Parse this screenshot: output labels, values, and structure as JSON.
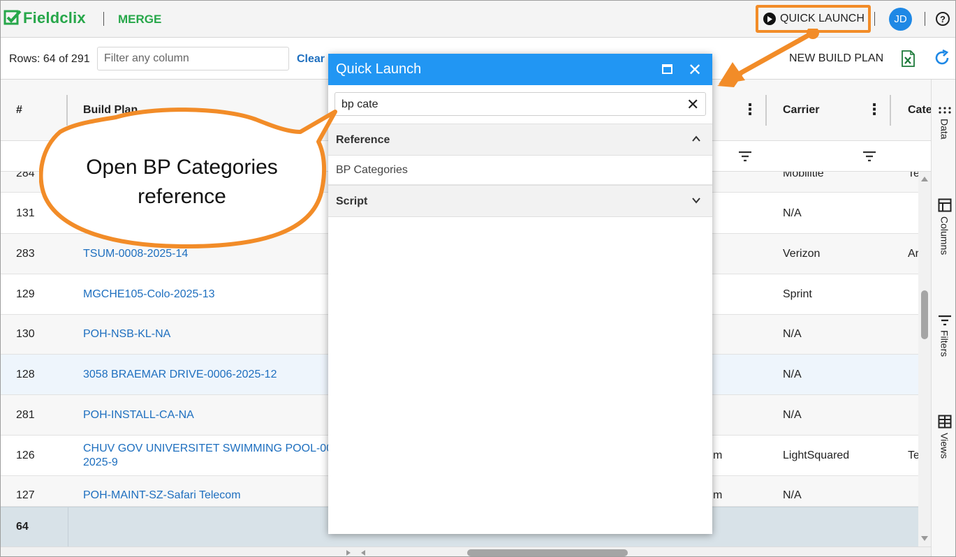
{
  "app": {
    "name": "Fieldclix",
    "module": "MERGE"
  },
  "header": {
    "quick_launch_label": "QUICK LAUNCH",
    "avatar_initials": "JD",
    "help_glyph": "?"
  },
  "toolbar": {
    "rows_label": "Rows: 64 of 291",
    "filter_placeholder": "Filter any column",
    "clear_label": "Clear",
    "new_build_plan_label": "NEW BUILD PLAN"
  },
  "grid": {
    "columns": [
      "#",
      "Build Plan",
      "Carrier",
      "Cate"
    ],
    "rows": [
      {
        "num": "284",
        "build_plan": "",
        "mid": "",
        "carrier": "Mobilitie",
        "category": "Te"
      },
      {
        "num": "131",
        "build_plan": "",
        "mid": "",
        "carrier": "N/A",
        "category": ""
      },
      {
        "num": "283",
        "build_plan": "TSUM-0008-2025-14",
        "mid": "",
        "carrier": "Verizon",
        "category": "Ar"
      },
      {
        "num": "129",
        "build_plan": "MGCHE105-Colo-2025-13",
        "mid": "",
        "carrier": "Sprint",
        "category": ""
      },
      {
        "num": "130",
        "build_plan": "POH-NSB-KL-NA",
        "mid": "",
        "carrier": "N/A",
        "category": ""
      },
      {
        "num": "128",
        "build_plan": "3058 BRAEMAR DRIVE-0006-2025-12",
        "mid": "",
        "carrier": "N/A",
        "category": ""
      },
      {
        "num": "281",
        "build_plan": "POH-INSTALL-CA-NA",
        "mid": "",
        "carrier": "N/A",
        "category": ""
      },
      {
        "num": "126",
        "build_plan": "CHUV GOV UNIVERSITET SWIMMING POOL-000",
        "build_plan_line2": "2025-9",
        "mid": "m",
        "carrier": "LightSquared",
        "category": "Te"
      },
      {
        "num": "127",
        "build_plan": "POH-MAINT-SZ-Safari Telecom",
        "mid": "m",
        "carrier": "N/A",
        "category": ""
      }
    ],
    "footer_count": "64"
  },
  "side_panel": {
    "items": [
      "Data",
      "Columns",
      "Filters",
      "Views"
    ]
  },
  "callout": {
    "line1": "Open BP Categories",
    "line2": "reference"
  },
  "quick_launch": {
    "title": "Quick Launch",
    "search_value": "bp cate",
    "sections": [
      {
        "label": "Reference",
        "expanded": true,
        "items": [
          "BP Categories"
        ]
      },
      {
        "label": "Script",
        "expanded": false,
        "items": []
      }
    ]
  },
  "colors": {
    "brand_green": "#27a74a",
    "accent_orange": "#f28c28",
    "dialog_blue": "#2196f3",
    "link_blue": "#1e6fbf"
  }
}
